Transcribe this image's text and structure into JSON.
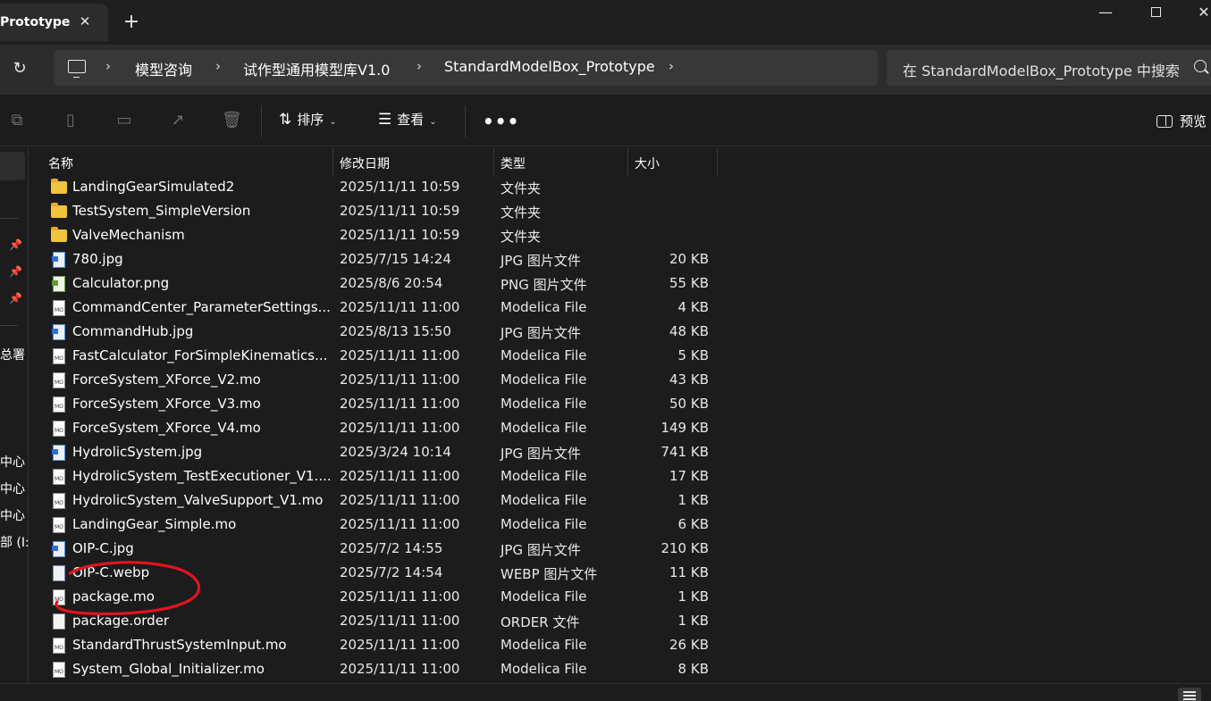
{
  "window": {
    "tab_title": "Prototype",
    "tab_close": "✕",
    "new_tab": "+",
    "minimize": "—",
    "close": "✕"
  },
  "address": {
    "refresh_icon": "↻",
    "separator": "›",
    "breadcrumbs": [
      "模型咨询",
      "试作型通用模型库V1.0",
      "StandardModelBox_Prototype"
    ],
    "search_placeholder": "在 StandardModelBox_Prototype 中搜索"
  },
  "toolbar": {
    "sort_label": "排序",
    "view_label": "查看",
    "more_label": "•••",
    "preview_label": "预览"
  },
  "navpane": {
    "truncated_labels": [
      "总署",
      "中心",
      "中心",
      "中心",
      "部 (I:"
    ]
  },
  "columns": {
    "name": "名称",
    "date": "修改日期",
    "type": "类型",
    "size": "大小"
  },
  "files": [
    {
      "name": "LandingGearSimulated2",
      "date": "2025/11/11 10:59",
      "type": "文件夹",
      "size": "",
      "icon": "folder"
    },
    {
      "name": "TestSystem_SimpleVersion",
      "date": "2025/11/11 10:59",
      "type": "文件夹",
      "size": "",
      "icon": "folder"
    },
    {
      "name": "ValveMechanism",
      "date": "2025/11/11 10:59",
      "type": "文件夹",
      "size": "",
      "icon": "folder"
    },
    {
      "name": "780.jpg",
      "date": "2025/7/15 14:24",
      "type": "JPG 图片文件",
      "size": "20 KB",
      "icon": "jpg"
    },
    {
      "name": "Calculator.png",
      "date": "2025/8/6 20:54",
      "type": "PNG 图片文件",
      "size": "55 KB",
      "icon": "png"
    },
    {
      "name": "CommandCenter_ParameterSettings....",
      "date": "2025/11/11 11:00",
      "type": "Modelica File",
      "size": "4 KB",
      "icon": "mo"
    },
    {
      "name": "CommandHub.jpg",
      "date": "2025/8/13 15:50",
      "type": "JPG 图片文件",
      "size": "48 KB",
      "icon": "jpg"
    },
    {
      "name": "FastCalculator_ForSimpleKinematics...",
      "date": "2025/11/11 11:00",
      "type": "Modelica File",
      "size": "5 KB",
      "icon": "mo"
    },
    {
      "name": "ForceSystem_XForce_V2.mo",
      "date": "2025/11/11 11:00",
      "type": "Modelica File",
      "size": "43 KB",
      "icon": "mo"
    },
    {
      "name": "ForceSystem_XForce_V3.mo",
      "date": "2025/11/11 11:00",
      "type": "Modelica File",
      "size": "50 KB",
      "icon": "mo"
    },
    {
      "name": "ForceSystem_XForce_V4.mo",
      "date": "2025/11/11 11:00",
      "type": "Modelica File",
      "size": "149 KB",
      "icon": "mo"
    },
    {
      "name": "HydrolicSystem.jpg",
      "date": "2025/3/24 10:14",
      "type": "JPG 图片文件",
      "size": "741 KB",
      "icon": "jpg"
    },
    {
      "name": "HydrolicSystem_TestExecutioner_V1....",
      "date": "2025/11/11 11:00",
      "type": "Modelica File",
      "size": "17 KB",
      "icon": "mo"
    },
    {
      "name": "HydrolicSystem_ValveSupport_V1.mo",
      "date": "2025/11/11 11:00",
      "type": "Modelica File",
      "size": "1 KB",
      "icon": "mo"
    },
    {
      "name": "LandingGear_Simple.mo",
      "date": "2025/11/11 11:00",
      "type": "Modelica File",
      "size": "6 KB",
      "icon": "mo"
    },
    {
      "name": "OIP-C.jpg",
      "date": "2025/7/2 14:55",
      "type": "JPG 图片文件",
      "size": "210 KB",
      "icon": "jpg"
    },
    {
      "name": "OIP-C.webp",
      "date": "2025/7/2 14:54",
      "type": "WEBP 图片文件",
      "size": "11 KB",
      "icon": "webp"
    },
    {
      "name": "package.mo",
      "date": "2025/11/11 11:00",
      "type": "Modelica File",
      "size": "1 KB",
      "icon": "mo"
    },
    {
      "name": "package.order",
      "date": "2025/11/11 11:00",
      "type": "ORDER 文件",
      "size": "1 KB",
      "icon": "doc"
    },
    {
      "name": "StandardThrustSystemInput.mo",
      "date": "2025/11/11 11:00",
      "type": "Modelica File",
      "size": "26 KB",
      "icon": "mo"
    },
    {
      "name": "System_Global_Initializer.mo",
      "date": "2025/11/11 11:00",
      "type": "Modelica File",
      "size": "8 KB",
      "icon": "mo"
    }
  ],
  "colors": {
    "background": "#1c1c1c",
    "annotation": "#e0141e",
    "folder": "#f3c33c"
  }
}
